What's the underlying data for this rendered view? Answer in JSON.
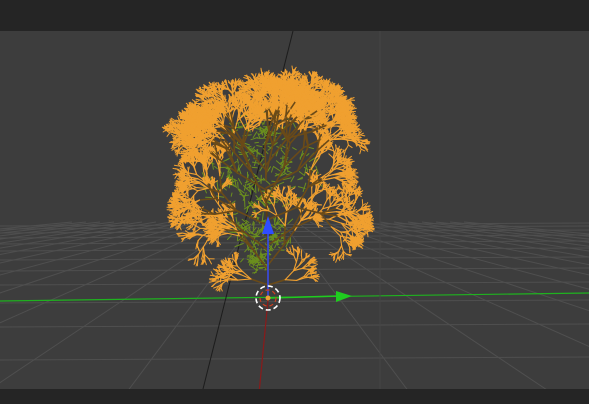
{
  "app": {
    "name": "3D viewport",
    "scene": {
      "object": "tree",
      "object_state": "selected",
      "selection_outline_color": "#f0a030",
      "foliage_color": "#6b8f1e",
      "grid_visible": true
    },
    "gizmo": {
      "z_axis_color": "#2f4dff",
      "y_axis_color": "#1fcc1f",
      "x_axis_color": "#a01c1c",
      "pivot": "3d-cursor"
    },
    "colors": {
      "viewport_bg": "#3d3d3d",
      "header_bg": "#252525",
      "grid_line": "#505050"
    }
  }
}
